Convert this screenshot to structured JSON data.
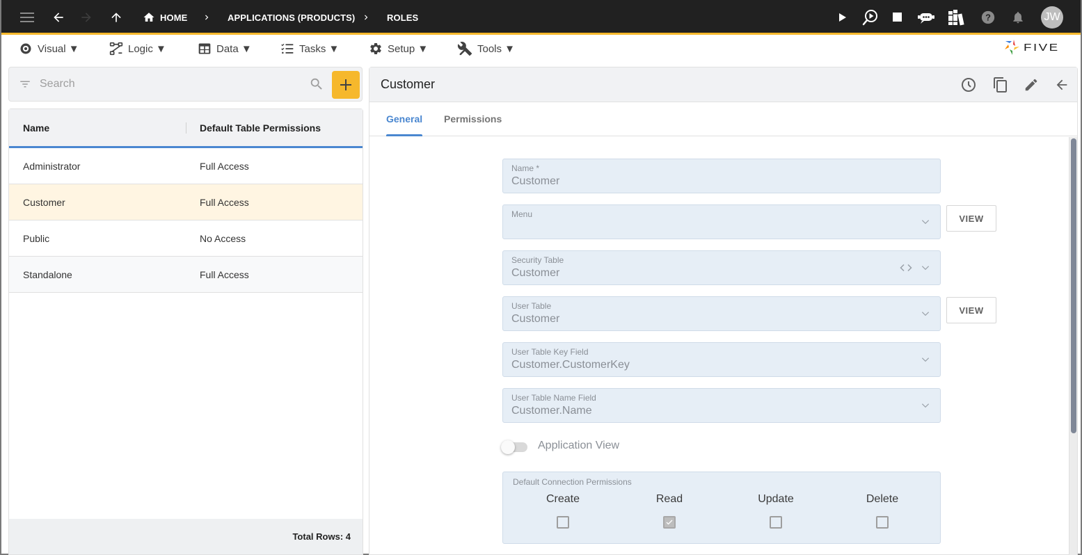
{
  "appbar": {
    "icons": [
      "menu-icon",
      "back-arrow-icon",
      "forward-arrow-icon",
      "up-arrow-icon"
    ],
    "breadcrumb": [
      {
        "label": "HOME",
        "icon": "home-icon"
      },
      {
        "label": "APPLICATIONS (PRODUCTS)"
      },
      {
        "label": "ROLES"
      }
    ],
    "right_icons": [
      "run-icon",
      "debug-run-icon",
      "stop-icon",
      "chat-bot-icon",
      "library-icon",
      "help-icon",
      "notifications-icon"
    ],
    "avatar_initials": "JW",
    "accent_color": "#f6b82c"
  },
  "menubar": {
    "items": [
      {
        "label": "Visual ▼",
        "icon": "eye-icon"
      },
      {
        "label": "Logic ▼",
        "icon": "logic-flow-icon"
      },
      {
        "label": "Data ▼",
        "icon": "table-icon"
      },
      {
        "label": "Tasks ▼",
        "icon": "checklist-icon"
      },
      {
        "label": "Setup ▼",
        "icon": "gear-icon"
      },
      {
        "label": "Tools ▼",
        "icon": "tools-icon"
      }
    ],
    "logo_text": "FIVE"
  },
  "list": {
    "search_placeholder": "Search",
    "columns": [
      "Name",
      "Default Table Permissions"
    ],
    "rows": [
      {
        "name": "Administrator",
        "permissions": "Full Access"
      },
      {
        "name": "Customer",
        "permissions": "Full Access",
        "selected": true
      },
      {
        "name": "Public",
        "permissions": "No Access"
      },
      {
        "name": "Standalone",
        "permissions": "Full Access"
      }
    ],
    "footer": "Total Rows: 4"
  },
  "detail": {
    "title": "Customer",
    "header_icons": [
      "history-icon",
      "copy-icon",
      "edit-icon",
      "back-icon"
    ],
    "tabs": [
      {
        "label": "General",
        "active": true
      },
      {
        "label": "Permissions",
        "active": false
      }
    ],
    "fields": {
      "name": {
        "label": "Name *",
        "value": "Customer"
      },
      "menu": {
        "label": "Menu",
        "value": ""
      },
      "security_table": {
        "label": "Security Table",
        "value": "Customer"
      },
      "user_table": {
        "label": "User Table",
        "value": "Customer"
      },
      "user_table_key_field": {
        "label": "User Table Key Field",
        "value": "Customer.CustomerKey"
      },
      "user_table_name_field": {
        "label": "User Table Name Field",
        "value": "Customer.Name"
      }
    },
    "view_label": "VIEW",
    "application_view": {
      "label": "Application View",
      "on": false
    },
    "connection_permissions": {
      "label": "Default Connection Permissions",
      "items": [
        {
          "label": "Create",
          "checked": false
        },
        {
          "label": "Read",
          "checked": true
        },
        {
          "label": "Update",
          "checked": false
        },
        {
          "label": "Delete",
          "checked": false
        }
      ]
    },
    "active_tab_color": "#4a87d0"
  }
}
